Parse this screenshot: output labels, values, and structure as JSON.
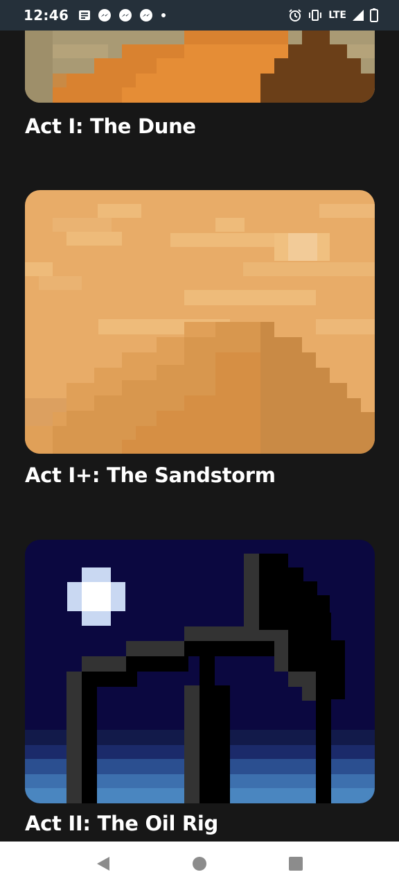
{
  "status_bar": {
    "time": "12:46",
    "network": "LTE",
    "left_icons": [
      "notes-icon",
      "messenger-icon",
      "messenger-icon",
      "messenger-icon",
      "dot-icon"
    ],
    "right_icons": [
      "alarm-icon",
      "vibrate-icon",
      "signal-icon",
      "battery-icon"
    ]
  },
  "levels": [
    {
      "title": "Act I: The Dune",
      "art": "dune"
    },
    {
      "title": "Act I+: The Sandstorm",
      "art": "sandstorm"
    },
    {
      "title": "Act II: The Oil Rig",
      "art": "oil-rig"
    }
  ],
  "colors": {
    "background": "#171717",
    "status_bar": "#25303a",
    "dune_orange": "#e58d36",
    "dune_shadow": "#6b3f18",
    "sand_light": "#e8ac68",
    "night_sky": "#0b0840",
    "moon": "#ffffff",
    "sea": "#4a86c0"
  },
  "nav_bar": [
    "back-icon",
    "home-icon",
    "recents-icon"
  ]
}
